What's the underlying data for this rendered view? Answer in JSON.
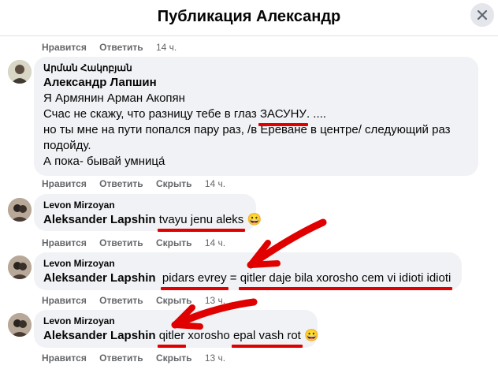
{
  "header": {
    "title": "Публикация Александр"
  },
  "actions": {
    "like": "Нравится",
    "reply": "Ответить",
    "hide": "Скрыть"
  },
  "comments": [
    {
      "time": "14 ч."
    },
    {
      "author": "Արման Հակոբյան",
      "mention": "Александр Лапшин",
      "lines": [
        "Я Армянин Арман Акопян",
        "Счас не скажу, что разницу тебе в глаз",
        "ЗАСУНУ",
        ". ....",
        "но ты мне на пути попался пару раз, /в Ереване в центре/ следующий раз",
        "подойду.",
        "А пока- бывай умница́"
      ],
      "time": "14 ч."
    },
    {
      "author": "Levon Mirzoyan",
      "mention": "Aleksander Lapshin",
      "text": "tvayu jenu aleks",
      "emoji": "😀",
      "time": "14 ч."
    },
    {
      "author": "Levon Mirzoyan",
      "mention": "Aleksander Lapshin",
      "t1": "pidars evrey",
      "t2": "=",
      "t3": "qitler daje bila xorosho cem vi idioti idioti",
      "time": "13 ч."
    },
    {
      "author": "Levon Mirzoyan",
      "mention": "Aleksander Lapshin",
      "t1": "qitler",
      "t2": "xorosho",
      "t3": "epal vash rot",
      "emoji": "😀",
      "time": "13 ч."
    }
  ],
  "colors": {
    "annotation": "#e00000",
    "bubble": "#f0f2f5",
    "meta": "#65676b"
  }
}
